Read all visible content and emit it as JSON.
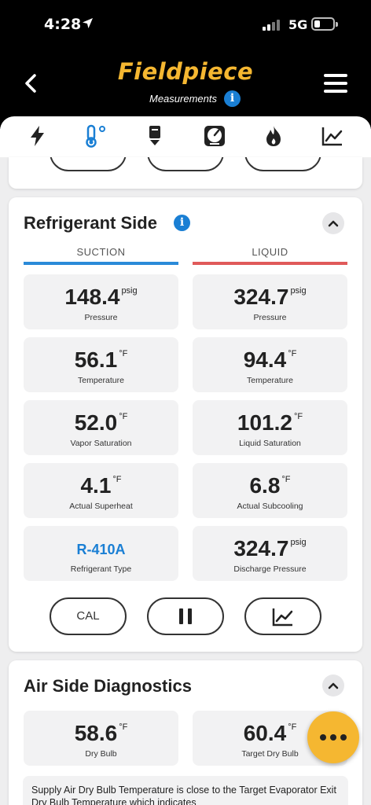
{
  "status": {
    "time": "4:28",
    "network": "5G"
  },
  "header": {
    "brand": "Fieldpiece",
    "subtitle": "Measurements"
  },
  "tabs": [
    {
      "icon": "bolt-icon"
    },
    {
      "icon": "thermometer-icon",
      "active": true
    },
    {
      "icon": "probe-icon"
    },
    {
      "icon": "gauge-icon"
    },
    {
      "icon": "flame-icon"
    },
    {
      "icon": "chart-icon"
    }
  ],
  "refrigerant": {
    "title": "Refrigerant Side",
    "suction_label": "SUCTION",
    "liquid_label": "LIQUID",
    "suction_color": "#2a8ad8",
    "liquid_color": "#e05a5a",
    "suction": [
      {
        "value": "148.4",
        "unit": "psig",
        "label": "Pressure"
      },
      {
        "value": "56.1",
        "unit": "°F",
        "label": "Temperature"
      },
      {
        "value": "52.0",
        "unit": "°F",
        "label": "Vapor Saturation"
      },
      {
        "value": "4.1",
        "unit": "°F",
        "label": "Actual Superheat"
      },
      {
        "value": "R-410A",
        "unit": "",
        "label": "Refrigerant Type"
      }
    ],
    "liquid": [
      {
        "value": "324.7",
        "unit": "psig",
        "label": "Pressure"
      },
      {
        "value": "94.4",
        "unit": "°F",
        "label": "Temperature"
      },
      {
        "value": "101.2",
        "unit": "°F",
        "label": "Liquid Saturation"
      },
      {
        "value": "6.8",
        "unit": "°F",
        "label": "Actual Subcooling"
      },
      {
        "value": "324.7",
        "unit": "psig",
        "label": "Discharge Pressure"
      }
    ],
    "cal_label": "CAL"
  },
  "air": {
    "title": "Air Side Diagnostics",
    "tiles": [
      {
        "value": "58.6",
        "unit": "°F",
        "label": "Dry Bulb"
      },
      {
        "value": "60.4",
        "unit": "°F",
        "label": "Target Dry Bulb"
      }
    ],
    "advice": "Supply Air Dry Bulb Temperature is close to the Target Evaporator Exit Dry Bulb Temperature which indicates"
  },
  "colors": {
    "brand": "#f5b731",
    "accent": "#1a7fd4"
  }
}
